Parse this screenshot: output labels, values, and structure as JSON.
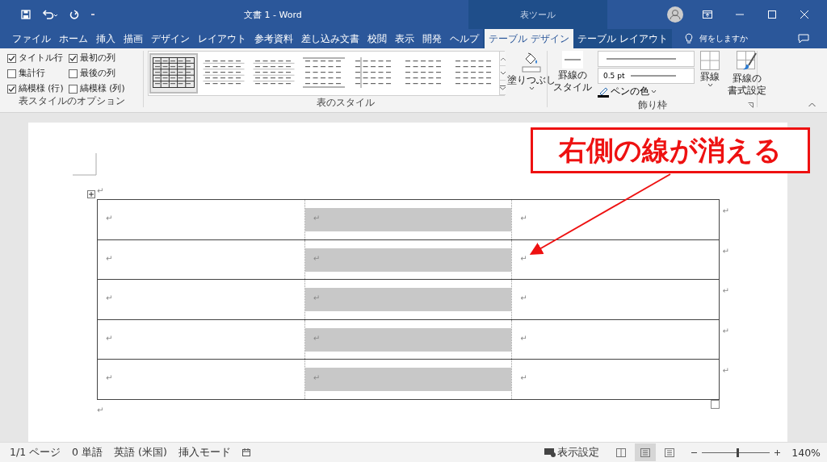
{
  "title_bar": {
    "title": "文書 1 - Word",
    "context_label": "表ツール"
  },
  "menu_tabs": [
    {
      "label": "ファイル",
      "selected": false,
      "kind": "normal"
    },
    {
      "label": "ホーム",
      "selected": false,
      "kind": "normal"
    },
    {
      "label": "挿入",
      "selected": false,
      "kind": "normal"
    },
    {
      "label": "描画",
      "selected": false,
      "kind": "normal"
    },
    {
      "label": "デザイン",
      "selected": false,
      "kind": "normal"
    },
    {
      "label": "レイアウト",
      "selected": false,
      "kind": "normal"
    },
    {
      "label": "参考資料",
      "selected": false,
      "kind": "normal"
    },
    {
      "label": "差し込み文書",
      "selected": false,
      "kind": "normal"
    },
    {
      "label": "校閲",
      "selected": false,
      "kind": "normal"
    },
    {
      "label": "表示",
      "selected": false,
      "kind": "normal"
    },
    {
      "label": "開発",
      "selected": false,
      "kind": "normal"
    },
    {
      "label": "ヘルプ",
      "selected": false,
      "kind": "normal"
    },
    {
      "label": "テーブル デザイン",
      "selected": true,
      "kind": "context"
    },
    {
      "label": "テーブル レイアウト",
      "selected": false,
      "kind": "context"
    }
  ],
  "tell_me": "何をしますか",
  "ribbon": {
    "style_options": {
      "checkboxes": [
        {
          "label": "タイトル行",
          "checked": true
        },
        {
          "label": "最初の列",
          "checked": true
        },
        {
          "label": "集計行",
          "checked": false
        },
        {
          "label": "最後の列",
          "checked": false
        },
        {
          "label": "縞模様 (行)",
          "checked": true
        },
        {
          "label": "縞模様 (列)",
          "checked": false
        }
      ],
      "group_label": "表スタイルのオプション"
    },
    "table_styles": {
      "gallery": [
        {
          "selected": true
        },
        {
          "selected": false
        },
        {
          "selected": false
        },
        {
          "selected": false
        },
        {
          "selected": false
        },
        {
          "selected": false
        },
        {
          "selected": false
        }
      ],
      "shading_label": "塗りつぶし",
      "group_label": "表のスタイル"
    },
    "borders": {
      "border_styles_label": [
        "罫線の",
        "スタイル"
      ],
      "line_weight": "0.5 pt",
      "pen_color_label": "ペンの色",
      "borders_label": "罫線",
      "border_painter_label": [
        "罫線の",
        "書式設定"
      ],
      "group_label": "飾り枠"
    }
  },
  "document": {
    "before_table_mark": "↵",
    "rows": [
      {
        "cells": [
          {
            "text": "↵",
            "shaded": false
          },
          {
            "text": "↵",
            "shaded": true
          },
          {
            "text": "↵",
            "shaded": false
          }
        ],
        "end_mark": "↵"
      },
      {
        "cells": [
          {
            "text": "↵",
            "shaded": false
          },
          {
            "text": "↵",
            "shaded": true
          },
          {
            "text": "↵",
            "shaded": false
          }
        ],
        "end_mark": "↵"
      },
      {
        "cells": [
          {
            "text": "↵",
            "shaded": false
          },
          {
            "text": "↵",
            "shaded": true
          },
          {
            "text": "↵",
            "shaded": false
          }
        ],
        "end_mark": "↵"
      },
      {
        "cells": [
          {
            "text": "↵",
            "shaded": false
          },
          {
            "text": "↵",
            "shaded": true
          },
          {
            "text": "↵",
            "shaded": false
          }
        ],
        "end_mark": "↵"
      },
      {
        "cells": [
          {
            "text": "↵",
            "shaded": false
          },
          {
            "text": "↵",
            "shaded": true
          },
          {
            "text": "↵",
            "shaded": false
          }
        ],
        "end_mark": "↵"
      }
    ],
    "after_table_mark": "↵",
    "callout": "右側の線が消える"
  },
  "status_bar": {
    "items": [
      "1/1 ページ",
      "0 単語",
      "英語 (米国)",
      "挿入モード"
    ],
    "display_settings": "表示設定",
    "views": [
      {
        "selected": false
      },
      {
        "selected": true
      },
      {
        "selected": false
      }
    ],
    "zoom": {
      "level": 0.53,
      "reading": "140%"
    }
  }
}
